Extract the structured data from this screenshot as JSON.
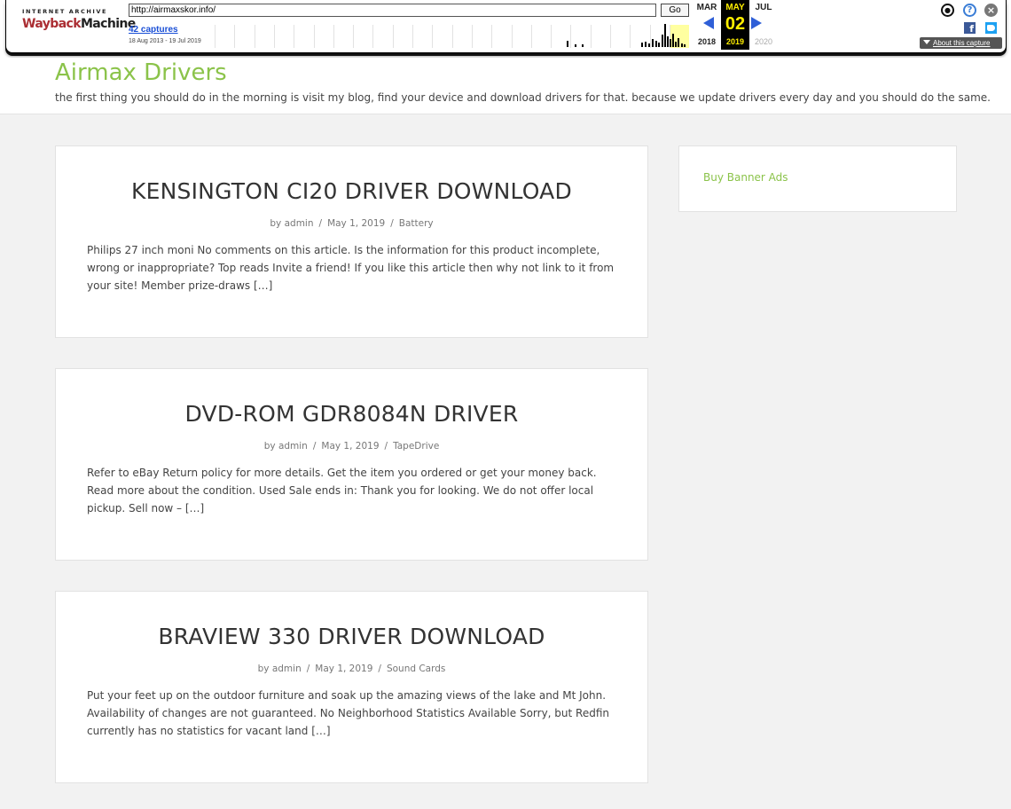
{
  "wayback": {
    "logo_top": "INTERNET ARCHIVE",
    "logo_wayback": "Wayback",
    "logo_machine": "Machine",
    "url": "http://airmaxskor.info/",
    "go_label": "Go",
    "captures": "42 captures",
    "date_range": "18 Aug 2013 - 19 Jul 2019",
    "prev_month": "MAR",
    "current_month": "MAY",
    "next_month": "JUL",
    "day": "02",
    "prev_year": "2018",
    "current_year": "2019",
    "next_year": "2020",
    "about_label": "About this capture",
    "icons": [
      "user-icon",
      "help-icon",
      "close-icon",
      "facebook-icon",
      "twitter-icon"
    ],
    "accent_color": "#ffee00"
  },
  "site": {
    "title": "Airmax Drivers",
    "tagline": "the first thing you should do in the morning is visit my blog, find your device and download drivers for that. because we update drivers every day and you should do the same.",
    "accent_color": "#8bc34a"
  },
  "posts": [
    {
      "title": "KENSINGTON CI20 DRIVER DOWNLOAD",
      "by": "by",
      "author": "admin",
      "date": "May 1, 2019",
      "category": "Battery",
      "excerpt": "Philips 27 inch moni No comments on this article. Is the information for this product incomplete, wrong or inappropriate? Top reads Invite a friend! If you like this article then why not link to it from your site! Member prize-draws […]"
    },
    {
      "title": "DVD-ROM GDR8084N DRIVER",
      "by": "by",
      "author": "admin",
      "date": "May 1, 2019",
      "category": "TapeDrive",
      "excerpt": "Refer to eBay Return policy for more details. Get the item you ordered or get your money back. Read more about the condition. Used Sale ends in: Thank you for looking. We do not offer local pickup. Sell now – […]"
    },
    {
      "title": "BRAVIEW 330 DRIVER DOWNLOAD",
      "by": "by",
      "author": "admin",
      "date": "May 1, 2019",
      "category": "Sound Cards",
      "excerpt": "Put your feet up on the outdoor furniture and soak up the amazing views of the lake and Mt John. Availability of changes are not guaranteed. No Neighborhood Statistics Available Sorry, but Redfin currently has no statistics for vacant land […]"
    }
  ],
  "meta_separator": "/",
  "sidebar": {
    "link": "Buy Banner Ads"
  }
}
